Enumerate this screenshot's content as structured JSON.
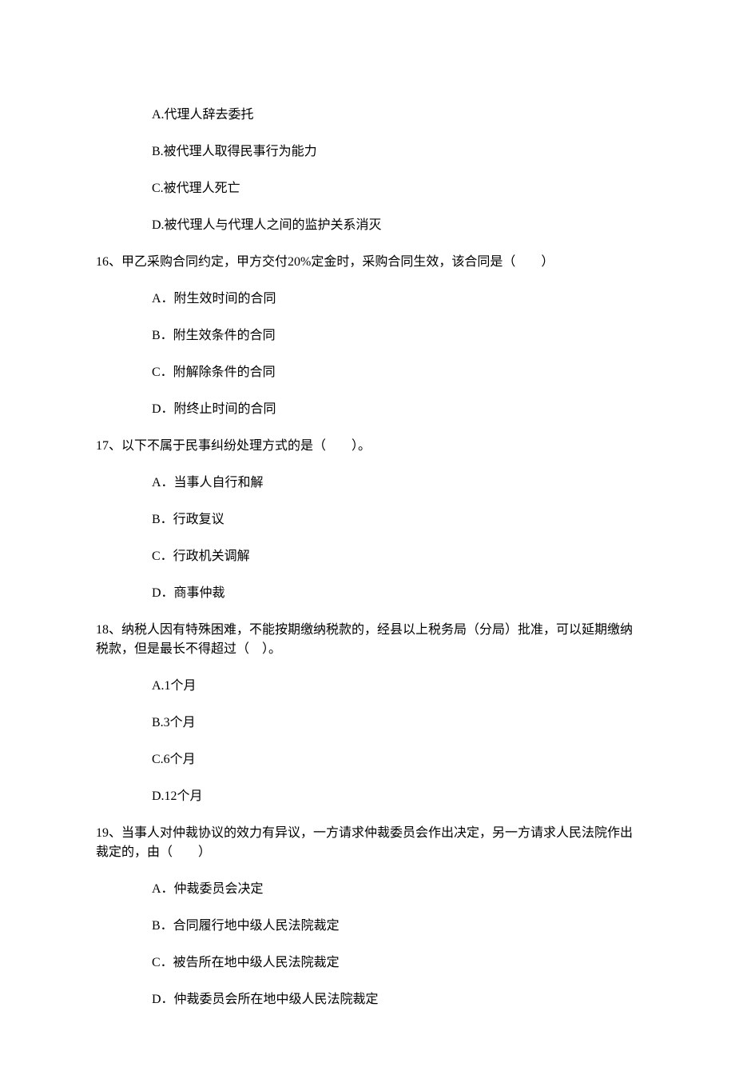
{
  "q15": {
    "options": {
      "a": "A.代理人辞去委托",
      "b": "B.被代理人取得民事行为能力",
      "c": "C.被代理人死亡",
      "d": "D.被代理人与代理人之间的监护关系消灭"
    }
  },
  "q16": {
    "stem": "16、甲乙采购合同约定，甲方交付20%定金时，采购合同生效，该合同是（　　）",
    "options": {
      "a": "A．附生效时间的合同",
      "b": "B．附生效条件的合同",
      "c": "C．附解除条件的合同",
      "d": "D．附终止时间的合同"
    }
  },
  "q17": {
    "stem": "17、以下不属于民事纠纷处理方式的是（　　）。",
    "options": {
      "a": "A．当事人自行和解",
      "b": "B．行政复议",
      "c": "C．行政机关调解",
      "d": "D．商事仲裁"
    }
  },
  "q18": {
    "stem": "18、纳税人因有特殊困难，不能按期缴纳税款的，经县以上税务局（分局）批准，可以延期缴纳税款，但是最长不得超过（　）。",
    "options": {
      "a": "A.1个月",
      "b": "B.3个月",
      "c": "C.6个月",
      "d": "D.12个月"
    }
  },
  "q19": {
    "stem": "19、当事人对仲裁协议的效力有异议，一方请求仲裁委员会作出决定，另一方请求人民法院作出裁定的，由（　　）",
    "options": {
      "a": "A．仲裁委员会决定",
      "b": "B．合同履行地中级人民法院裁定",
      "c": "C．被告所在地中级人民法院裁定",
      "d": "D．仲裁委员会所在地中级人民法院裁定"
    }
  }
}
